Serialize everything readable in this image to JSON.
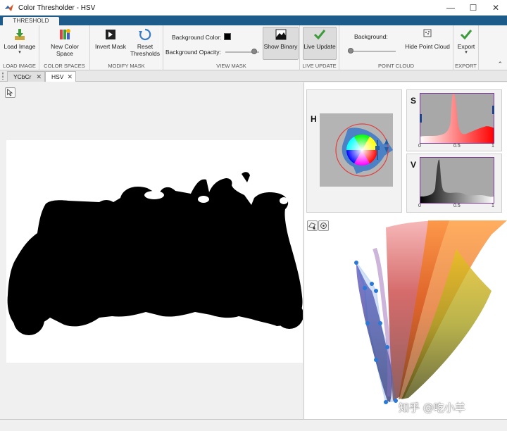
{
  "window": {
    "title": "Color Thresholder - HSV",
    "controls": {
      "minimize": "—",
      "maximize": "☐",
      "close": "✕"
    }
  },
  "ribbon": {
    "tab": "THRESHOLD",
    "groups": {
      "load_image": {
        "label": "LOAD IMAGE",
        "button": "Load Image"
      },
      "color_spaces": {
        "label": "COLOR SPACES",
        "button": "New Color Space"
      },
      "modify_mask": {
        "label": "MODIFY MASK",
        "invert": "Invert Mask",
        "reset_line1": "Reset",
        "reset_line2": "Thresholds"
      },
      "view_mask": {
        "label": "VIEW MASK",
        "bg_color": "Background Color:",
        "bg_opacity": "Background Opacity:",
        "show_binary": "Show Binary",
        "bg_color_value": "#000000",
        "opacity_level": 0.85
      },
      "live_update": {
        "label": "LIVE UPDATE",
        "button": "Live Update"
      },
      "point_cloud": {
        "label": "POINT CLOUD",
        "background": "Background:",
        "hide": "Hide Point Cloud",
        "bg_level": 0.0
      },
      "export": {
        "label": "EXPORT",
        "button": "Export"
      }
    },
    "collapse": "⌃"
  },
  "doctabs": [
    {
      "label": "YCbCr"
    },
    {
      "label": "HSV"
    }
  ],
  "channels": {
    "h": {
      "letter": "H"
    },
    "s": {
      "letter": "S",
      "ticks": [
        "0",
        "0.5",
        "1"
      ]
    },
    "v": {
      "letter": "V",
      "ticks": [
        "0",
        "0.5",
        "1"
      ]
    }
  },
  "watermark": "知乎 @吃小羊",
  "colors": {
    "ribbon_blue": "#1c5b8a",
    "selection_blue": "#1f5fa8"
  }
}
